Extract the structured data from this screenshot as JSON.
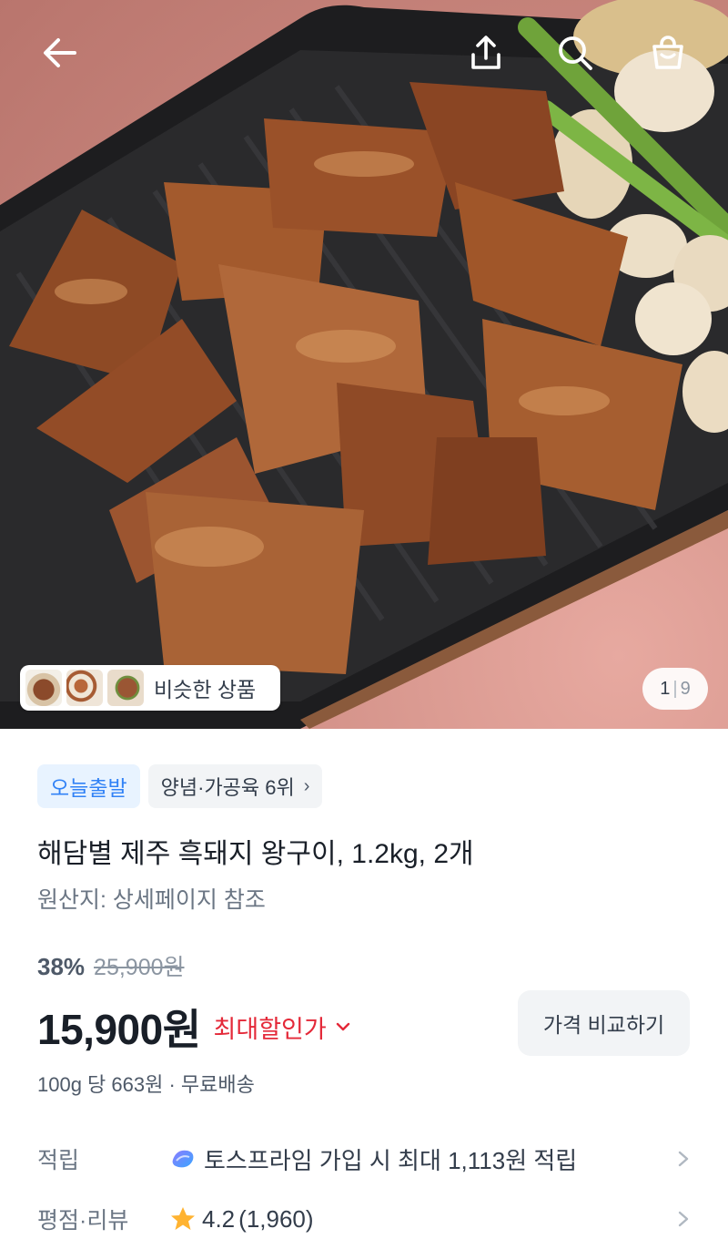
{
  "header": {
    "icons": [
      "back-icon",
      "share-icon",
      "search-icon",
      "cart-icon"
    ]
  },
  "gallery": {
    "similar_label": "비슷한 상품",
    "page_current": "1",
    "page_total": "9"
  },
  "badges": {
    "delivery": "오늘출발",
    "rank": "양념·가공육 6위"
  },
  "product": {
    "title": "해담별 제주 흑돼지 왕구이, 1.2kg, 2개",
    "origin": "원산지: 상세페이지 참조",
    "discount_rate": "38%",
    "original_price": "25,900원",
    "price": "15,900원",
    "max_discount_label": "최대할인가",
    "compare_button": "가격 비교하기",
    "unit_price": "100g 당 663원 · 무료배송"
  },
  "info_rows": {
    "points_label": "적립",
    "points_value": "토스프라임 가입 시 최대 1,113원 적립",
    "rating_label": "평점·리뷰",
    "rating_value": "4.2",
    "rating_count": "(1,960)"
  },
  "colors": {
    "accent_blue": "#3182f6",
    "discount_red": "#e42939",
    "text_primary": "#191f28",
    "text_secondary": "#6b7684",
    "star": "#ffb331"
  }
}
